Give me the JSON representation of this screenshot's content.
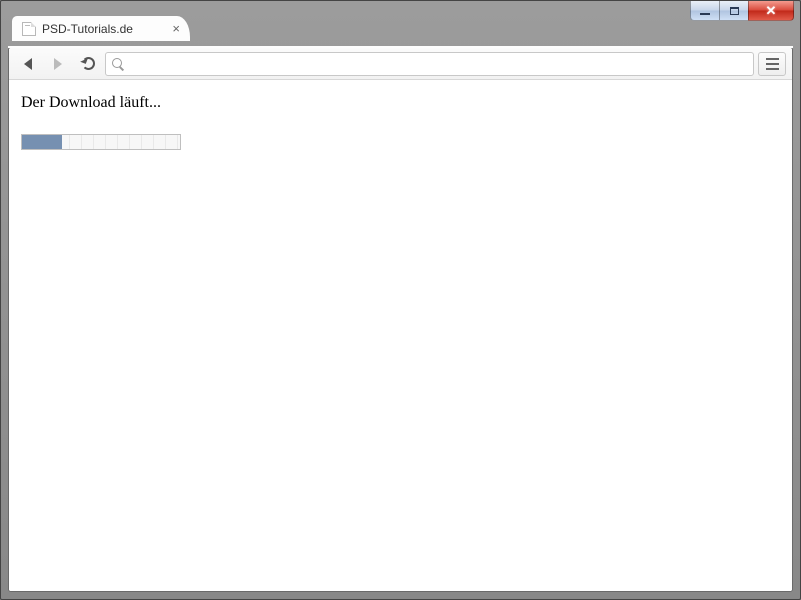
{
  "window": {
    "controls": {
      "minimize": "minimize",
      "maximize": "maximize",
      "close": "close"
    }
  },
  "tab": {
    "title": "PSD-Tutorials.de"
  },
  "toolbar": {
    "back": "Back",
    "forward": "Forward",
    "reload": "Reload",
    "address_value": "",
    "menu": "Menu"
  },
  "page": {
    "status_text": "Der Download läuft...",
    "progress": {
      "value": 25,
      "max": 100
    }
  }
}
